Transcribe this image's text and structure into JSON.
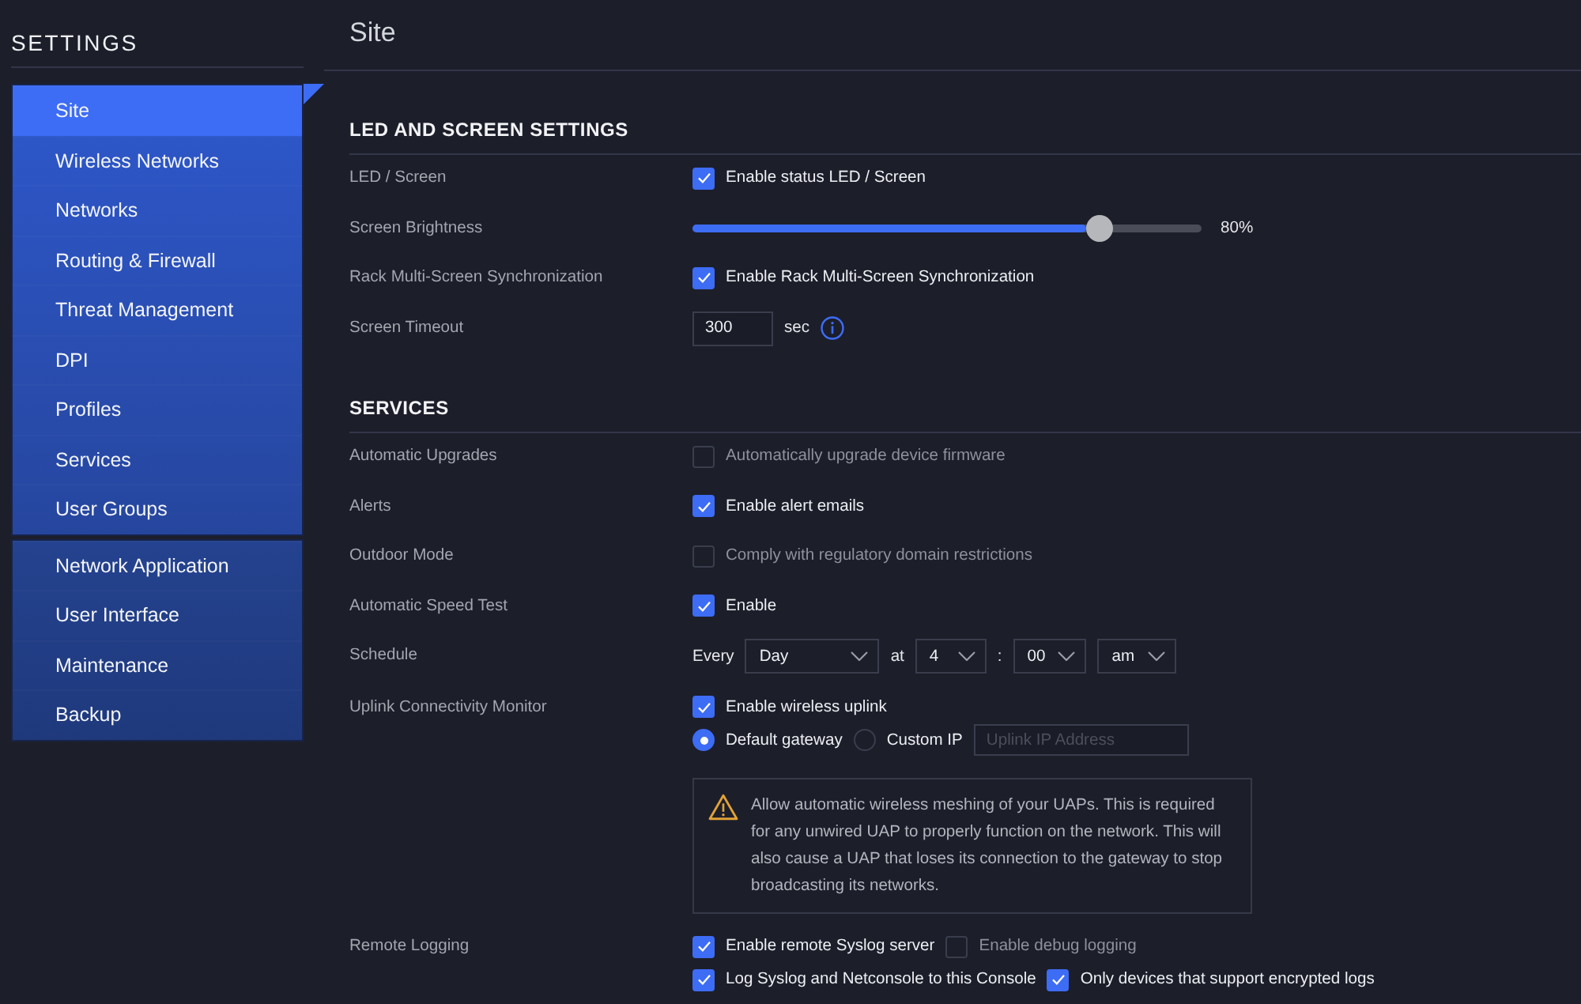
{
  "sidebar": {
    "title": "SETTINGS",
    "groups": [
      [
        {
          "label": "Site",
          "selected": true
        },
        {
          "label": "Wireless Networks",
          "selected": false
        },
        {
          "label": "Networks",
          "selected": false
        },
        {
          "label": "Routing & Firewall",
          "selected": false
        },
        {
          "label": "Threat Management",
          "selected": false
        },
        {
          "label": "DPI",
          "selected": false
        },
        {
          "label": "Profiles",
          "selected": false
        },
        {
          "label": "Services",
          "selected": false
        },
        {
          "label": "User Groups",
          "selected": false
        }
      ],
      [
        {
          "label": "Network Application",
          "selected": false
        },
        {
          "label": "User Interface",
          "selected": false
        },
        {
          "label": "Maintenance",
          "selected": false
        },
        {
          "label": "Backup",
          "selected": false
        }
      ]
    ]
  },
  "header": {
    "title": "Site"
  },
  "sections": [
    {
      "title": "LED AND SCREEN SETTINGS",
      "rows": [
        {
          "label": "LED / Screen",
          "lines": [
            [
              {
                "kind": "checkbox",
                "checked": true,
                "text": "Enable status LED / Screen"
              }
            ]
          ]
        },
        {
          "label": "Screen Brightness",
          "lines": [
            [
              {
                "kind": "slider",
                "level": 0.8
              },
              {
                "kind": "reading",
                "text": "80%"
              }
            ]
          ]
        },
        {
          "label": "Rack Multi-Screen Synchronization",
          "lines": [
            [
              {
                "kind": "checkbox",
                "checked": true,
                "text": "Enable Rack Multi-Screen Synchronization"
              }
            ]
          ]
        },
        {
          "label": "Screen Timeout",
          "lines": [
            [
              {
                "kind": "number_input",
                "value": "300"
              },
              {
                "kind": "unit",
                "text": "sec"
              },
              {
                "kind": "info"
              }
            ]
          ]
        }
      ]
    },
    {
      "title": "SERVICES",
      "rows": [
        {
          "label": "Automatic Upgrades",
          "lines": [
            [
              {
                "kind": "checkbox",
                "checked": false,
                "text": "Automatically upgrade device firmware"
              }
            ]
          ]
        },
        {
          "label": "Alerts",
          "lines": [
            [
              {
                "kind": "checkbox",
                "checked": true,
                "text": "Enable alert emails"
              }
            ]
          ]
        },
        {
          "label": "Outdoor Mode",
          "lines": [
            [
              {
                "kind": "checkbox",
                "checked": false,
                "text": "Comply with regulatory domain restrictions"
              }
            ]
          ]
        },
        {
          "label": "Automatic Speed Test",
          "lines": [
            [
              {
                "kind": "checkbox",
                "checked": true,
                "text": "Enable"
              }
            ]
          ]
        },
        {
          "label": "Schedule",
          "lines": [
            [
              {
                "kind": "text",
                "text": "Every"
              },
              {
                "kind": "select",
                "value": "Day"
              },
              {
                "kind": "text",
                "text": "at"
              },
              {
                "kind": "select",
                "value": "4"
              },
              {
                "kind": "text",
                "text": ":"
              },
              {
                "kind": "select",
                "value": "00"
              },
              {
                "kind": "select",
                "value": "am"
              }
            ]
          ]
        },
        {
          "label": "Uplink Connectivity Monitor",
          "lines": [
            [
              {
                "kind": "checkbox",
                "checked": true,
                "text": "Enable wireless uplink"
              }
            ],
            [
              {
                "kind": "radio",
                "selected": true,
                "text": "Default gateway"
              },
              {
                "kind": "radio",
                "selected": false,
                "text": "Custom IP"
              },
              {
                "kind": "text_input",
                "placeholder": "Uplink IP Address"
              }
            ],
            [
              {
                "kind": "notice",
                "text": "Allow automatic wireless meshing of your UAPs. This is required for any unwired UAP to properly function on the network. This will also cause a UAP that loses its connection to the gateway to stop broadcasting its networks."
              }
            ]
          ]
        },
        {
          "label": "Remote Logging",
          "lines": [
            [
              {
                "kind": "checkbox",
                "checked": true,
                "text": "Enable remote Syslog server"
              },
              {
                "kind": "checkbox",
                "checked": false,
                "text": "Enable debug logging"
              }
            ],
            [
              {
                "kind": "checkbox",
                "checked": true,
                "text": "Log Syslog and Netconsole to this Console"
              },
              {
                "kind": "checkbox",
                "checked": true,
                "text": "Only devices that support encrypted logs"
              }
            ]
          ]
        }
      ]
    }
  ]
}
